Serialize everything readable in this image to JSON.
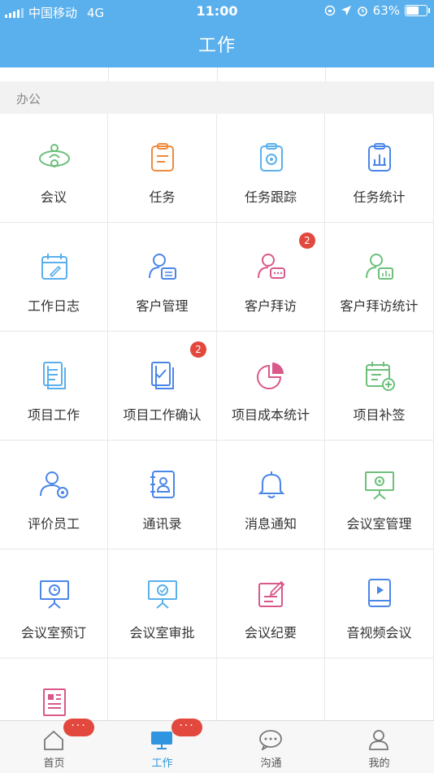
{
  "status_bar": {
    "carrier": "中国移动",
    "network": "4G",
    "time": "11:00",
    "battery": "63%"
  },
  "header": {
    "title": "工作"
  },
  "section": {
    "title": "办公"
  },
  "grid": [
    {
      "label": "会议",
      "icon": "meeting-icon",
      "color": "#6cc07a"
    },
    {
      "label": "任务",
      "icon": "task-clipboard-icon",
      "color": "#f08a3c"
    },
    {
      "label": "任务跟踪",
      "icon": "task-tracking-icon",
      "color": "#5ab0ec"
    },
    {
      "label": "任务统计",
      "icon": "task-statistics-icon",
      "color": "#4a86e8"
    },
    {
      "label": "工作日志",
      "icon": "work-log-icon",
      "color": "#5ab0ec"
    },
    {
      "label": "客户管理",
      "icon": "customer-management-icon",
      "color": "#4a86e8"
    },
    {
      "label": "客户拜访",
      "icon": "customer-visit-icon",
      "color": "#d9598a",
      "badge": "2"
    },
    {
      "label": "客户拜访统计",
      "icon": "customer-visit-statistics-icon",
      "color": "#6cc07a"
    },
    {
      "label": "项目工作",
      "icon": "project-work-icon",
      "color": "#5ab0ec"
    },
    {
      "label": "项目工作确认",
      "icon": "project-confirm-icon",
      "color": "#4a86e8",
      "badge": "2"
    },
    {
      "label": "项目成本统计",
      "icon": "project-cost-pie-icon",
      "color": "#d9598a"
    },
    {
      "label": "项目补签",
      "icon": "project-supplement-icon",
      "color": "#6cc07a"
    },
    {
      "label": "评价员工",
      "icon": "evaluate-employee-icon",
      "color": "#4a86e8"
    },
    {
      "label": "通讯录",
      "icon": "contacts-book-icon",
      "color": "#4a86e8"
    },
    {
      "label": "消息通知",
      "icon": "bell-icon",
      "color": "#4a86e8"
    },
    {
      "label": "会议室管理",
      "icon": "meeting-room-management-icon",
      "color": "#6cc07a"
    },
    {
      "label": "会议室预订",
      "icon": "meeting-room-booking-icon",
      "color": "#4a86e8"
    },
    {
      "label": "会议室审批",
      "icon": "meeting-room-approval-icon",
      "color": "#5ab0ec"
    },
    {
      "label": "会议纪要",
      "icon": "meeting-minutes-icon",
      "color": "#d9598a"
    },
    {
      "label": "音视频会议",
      "icon": "video-conference-icon",
      "color": "#4a86e8"
    },
    {
      "label": "",
      "icon": "newspaper-icon",
      "color": "#d9598a"
    }
  ],
  "tabbar": {
    "tabs": [
      {
        "label": "首页",
        "icon": "home-icon",
        "badge": "···"
      },
      {
        "label": "工作",
        "icon": "work-monitor-icon",
        "badge": "···",
        "active": true
      },
      {
        "label": "沟通",
        "icon": "chat-bubble-icon"
      },
      {
        "label": "我的",
        "icon": "profile-icon"
      }
    ]
  },
  "colors": {
    "header": "#5ab0ec",
    "active_tab": "#2f95e0",
    "badge": "#e2483d"
  }
}
